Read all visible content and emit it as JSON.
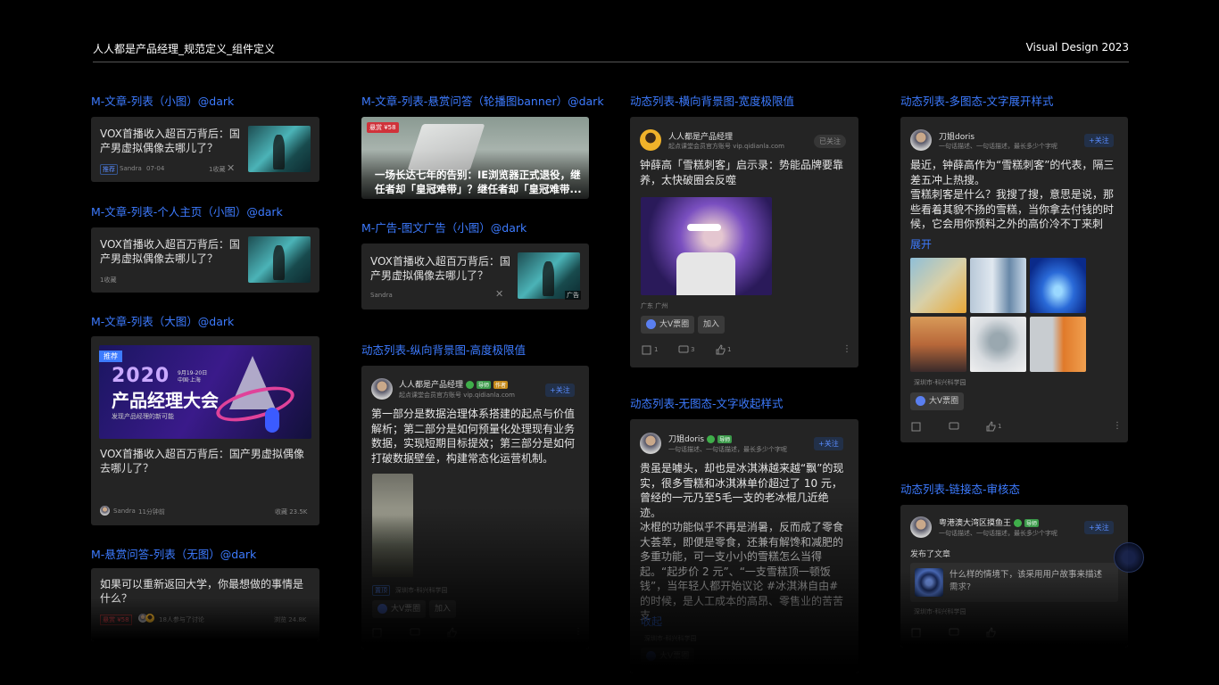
{
  "header": {
    "title": "人人都是产品经理_规范定义_组件定义",
    "right": "Visual Design  2023"
  },
  "col1": {
    "sec1": "M-文章-列表（小图）@dark",
    "c1": {
      "title": "VOX首播收入超百万背后：国产男虚拟偶像去哪儿了？",
      "tag": "推荐",
      "author": "Sandra",
      "date": "07-04",
      "count": "1收藏"
    },
    "sec2": "M-文章-列表-个人主页（小图）@dark",
    "c2": {
      "title": "VOX首播收入超百万背后：国产男虚拟偶像去哪儿了？",
      "count": "1收藏"
    },
    "sec3": "M-文章-列表（大图）@dark",
    "c3": {
      "banner_tag": "推荐",
      "banner_year": "2020",
      "banner_title": "产品经理大会",
      "banner_sub": "发现产品经理的新可能",
      "banner_date": "9月19-20日",
      "banner_place": "中国·上海",
      "title": "VOX首播收入超百万背后：国产男虚拟偶像去哪儿了？",
      "author": "Sandra",
      "time": "11分钟前",
      "count": "收藏 23.5K"
    },
    "sec4": "M-悬赏问答-列表（无图）@dark",
    "c4": {
      "title": "如果可以重新返回大学，你最想做的事情是什么？",
      "reward": "悬赏 ¥58",
      "people": "18人参与了讨论",
      "views": "浏览 24.8K"
    }
  },
  "col2": {
    "sec1": "M-文章-列表-悬赏问答（轮播图banner）@dark",
    "c1": {
      "reward": "悬赏 ¥58",
      "title": "一场长达七年的告别：IE浏览器正式退役，继任者却「皇冠难带」？继任者却「皇冠难带..."
    },
    "sec2": "M-广告-图文广告（小图）@dark",
    "c2": {
      "title": "VOX首播收入超百万背后：国产男虚拟偶像去哪儿了？",
      "author": "Sandra",
      "ad": "广告"
    },
    "sec3": "动态列表-纵向背景图-高度极限值",
    "c3": {
      "name": "人人都是产品经理",
      "badge1": "导师",
      "badge2": "作者",
      "desc": "起点课堂会员官方账号 vip.qidianla.com",
      "follow": "+关注",
      "text": "第一部分是数据治理体系搭建的起点与价值解析；第二部分是如何预量化处理现有业务数据，实现短期目标提效；第三部分是如何打破数据壁垒，构建常态化运营机制。",
      "tag": "置顶",
      "location": "深圳市-科兴科学园",
      "chip": "大V票圈",
      "join": "加入"
    }
  },
  "col3": {
    "sec1": "动态列表-横向背景图-宽度极限值",
    "c1": {
      "name": "人人都是产品经理",
      "desc": "起点课堂会员官方账号 vip.qidianla.com",
      "followed": "已关注",
      "text": "钟薛高「雪糕刺客」启示录：势能品牌要靠养，太快破圈会反噬",
      "location": "广东 广州",
      "chip": "大V票圈",
      "join": "加入",
      "share": "1",
      "comment": "3",
      "like": "1"
    },
    "sec2": "动态列表-无图态-文字收起样式",
    "c2": {
      "name": "刀姐doris",
      "badge": "导师",
      "desc": "一句话描述、一句话描述，最长多少个字呢",
      "follow": "+关注",
      "text": "贵虽是噱头，却也是冰淇淋越来越“飘”的现实，很多雪糕和冰淇淋单价超过了 10 元，曾经的一元乃至5毛一支的老冰棍几近绝迹。\n冰棍的功能似乎不再是消暑，反而成了零食大荟萃，即便是零食，还兼有解馋和减肥的多重功能，可一支小小的雪糕怎么当得起。“起步价 2 元”、“一支雪糕顶一顿饭钱”，当年轻人都开始议论 #冰淇淋自由# 的时候，是人工成本的高昂、零售业的苦苦支",
      "collapse": "收起",
      "location": "深圳市-科兴科学园",
      "chip": "大V票圈"
    }
  },
  "col4": {
    "sec1": "动态列表-多图态-文字展开样式",
    "c1": {
      "name": "刀姐doris",
      "desc": "一句话描述、一句话描述，最长多少个字呢",
      "follow": "+关注",
      "text": "最近，钟薛高作为“雪糕刺客”的代表，隔三差五冲上热搜。\n雪糕刺客是什么？我搜了搜，意思是说，那些看着其貌不扬的雪糕，当你拿去付钱的时候，它会用你预料之外的高价冷不丁来刺",
      "expand": "展开",
      "location": "深圳市-科兴科学园",
      "chip": "大V票圈",
      "share": "",
      "comment": "",
      "like": "1"
    },
    "sec2": "动态列表-链接态-审核态",
    "c2": {
      "name": "粤港澳大湾区摸鱼王",
      "badge": "导师",
      "desc": "一句话描述、一句话描述，最长多少个字呢",
      "follow": "+关注",
      "posted": "发布了文章",
      "link": "什么样的情境下，该采用用户故事来描述需求?",
      "location": "深圳市-科兴科学园"
    }
  }
}
